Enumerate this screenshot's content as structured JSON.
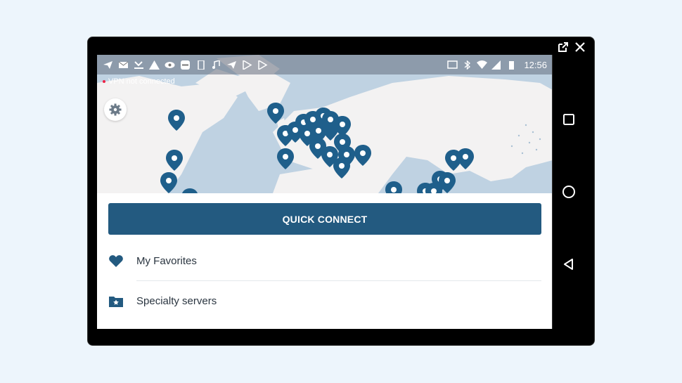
{
  "statusbar": {
    "time": "12:56"
  },
  "vpn": {
    "status_text": "VPN not connected"
  },
  "panel": {
    "quick_connect_label": "QUICK CONNECT",
    "favorites_label": "My Favorites",
    "specialty_label": "Specialty servers"
  },
  "colors": {
    "accent": "#235a80",
    "pin": "#1f5f8b",
    "map_water": "#bfd2e2",
    "map_land": "#f3f2f2"
  },
  "icons": {
    "settings": "gear-icon",
    "favorites": "heart-icon",
    "specialty": "folder-star-icon",
    "popout": "external-link-icon",
    "close": "close-icon",
    "recent": "square-icon",
    "home": "circle-icon",
    "back": "triangle-back-icon"
  }
}
